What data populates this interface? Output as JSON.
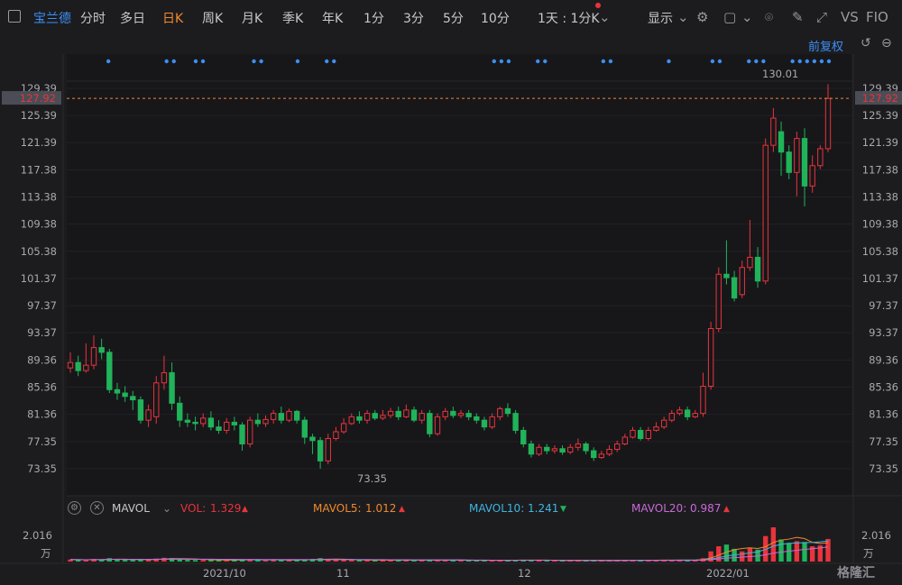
{
  "toolbar": {
    "stock_name": "宝兰德",
    "periods": [
      "分时",
      "多日",
      "日K",
      "周K",
      "月K",
      "季K",
      "年K",
      "1分",
      "3分",
      "5分",
      "10分",
      "1天 : 1分K"
    ],
    "active_period": "日K",
    "display_label": "显示",
    "compare_label": "VS",
    "f10_label": "FIO"
  },
  "chart_header": {
    "adjust_label": "前复权"
  },
  "price_axis": {
    "ticks": [
      "129.39",
      "125.39",
      "121.39",
      "117.38",
      "113.38",
      "109.38",
      "105.38",
      "101.37",
      "97.37",
      "93.37",
      "89.36",
      "85.36",
      "81.36",
      "77.35",
      "73.35"
    ],
    "current_price": "127.92",
    "high_label": "130.01",
    "low_label": "73.35"
  },
  "date_axis": {
    "labels": [
      "2021/10",
      "11",
      "12",
      "2022/01"
    ]
  },
  "volume": {
    "indicator": "MAVOL",
    "vol_label": "VOL:",
    "vol_value": "1.329",
    "mavol5_label": "MAVOL5:",
    "mavol5_value": "1.012",
    "mavol10_label": "MAVOL10:",
    "mavol10_value": "1.241",
    "mavol20_label": "MAVOL20:",
    "mavol20_value": "0.987",
    "axis_max": "2.016",
    "axis_unit": "万"
  },
  "colors": {
    "up": "#e8343c",
    "down": "#21b35a",
    "accent": "#3d8ff5",
    "active": "#f08a2c",
    "mavol5": "#f08a2c",
    "mavol10": "#3fb6e0",
    "mavol20": "#c86ad6"
  },
  "logo": "格隆汇",
  "chart_data": {
    "type": "candlestick",
    "y_range": [
      73.35,
      130.01
    ],
    "candles": [
      {
        "o": 88.2,
        "c": 89.0,
        "h": 90.5,
        "l": 87.5
      },
      {
        "o": 89.0,
        "c": 87.8,
        "h": 90.0,
        "l": 87.0
      },
      {
        "o": 87.8,
        "c": 88.6,
        "h": 91.8,
        "l": 87.5
      },
      {
        "o": 88.6,
        "c": 91.2,
        "h": 93.0,
        "l": 88.0
      },
      {
        "o": 91.2,
        "c": 90.5,
        "h": 92.5,
        "l": 89.5
      },
      {
        "o": 90.5,
        "c": 85.0,
        "h": 91.0,
        "l": 84.5
      },
      {
        "o": 85.0,
        "c": 84.5,
        "h": 86.0,
        "l": 83.5
      },
      {
        "o": 84.5,
        "c": 84.0,
        "h": 85.5,
        "l": 83.2
      },
      {
        "o": 84.0,
        "c": 83.5,
        "h": 84.8,
        "l": 82.0
      },
      {
        "o": 83.5,
        "c": 80.5,
        "h": 84.0,
        "l": 80.0
      },
      {
        "o": 80.5,
        "c": 82.0,
        "h": 82.8,
        "l": 79.5
      },
      {
        "o": 81.0,
        "c": 86.0,
        "h": 87.0,
        "l": 80.0
      },
      {
        "o": 86.0,
        "c": 87.5,
        "h": 90.0,
        "l": 85.0
      },
      {
        "o": 87.5,
        "c": 83.0,
        "h": 89.0,
        "l": 82.0
      },
      {
        "o": 83.0,
        "c": 80.5,
        "h": 84.0,
        "l": 79.5
      },
      {
        "o": 80.5,
        "c": 80.2,
        "h": 81.5,
        "l": 79.5
      },
      {
        "o": 80.2,
        "c": 80.0,
        "h": 81.0,
        "l": 79.0
      },
      {
        "o": 80.0,
        "c": 80.8,
        "h": 81.5,
        "l": 79.5
      },
      {
        "o": 80.8,
        "c": 79.5,
        "h": 81.8,
        "l": 79.0
      },
      {
        "o": 79.5,
        "c": 79.0,
        "h": 80.5,
        "l": 78.5
      },
      {
        "o": 79.0,
        "c": 80.2,
        "h": 80.8,
        "l": 78.5
      },
      {
        "o": 80.2,
        "c": 79.8,
        "h": 81.0,
        "l": 79.0
      },
      {
        "o": 79.8,
        "c": 77.0,
        "h": 80.2,
        "l": 76.0
      },
      {
        "o": 77.0,
        "c": 80.5,
        "h": 81.0,
        "l": 76.5
      },
      {
        "o": 80.5,
        "c": 80.0,
        "h": 81.5,
        "l": 79.5
      },
      {
        "o": 80.0,
        "c": 80.6,
        "h": 81.2,
        "l": 79.5
      },
      {
        "o": 80.6,
        "c": 81.5,
        "h": 82.0,
        "l": 80.0
      },
      {
        "o": 81.5,
        "c": 80.5,
        "h": 82.5,
        "l": 80.0
      },
      {
        "o": 80.5,
        "c": 81.8,
        "h": 82.2,
        "l": 80.2
      },
      {
        "o": 81.8,
        "c": 80.5,
        "h": 82.0,
        "l": 80.0
      },
      {
        "o": 80.5,
        "c": 78.0,
        "h": 81.0,
        "l": 77.0
      },
      {
        "o": 78.0,
        "c": 77.5,
        "h": 78.5,
        "l": 75.5
      },
      {
        "o": 77.5,
        "c": 74.5,
        "h": 78.0,
        "l": 73.35
      },
      {
        "o": 74.5,
        "c": 77.8,
        "h": 78.5,
        "l": 74.0
      },
      {
        "o": 77.8,
        "c": 78.8,
        "h": 79.5,
        "l": 77.5
      },
      {
        "o": 78.8,
        "c": 80.0,
        "h": 80.8,
        "l": 78.5
      },
      {
        "o": 80.0,
        "c": 81.0,
        "h": 81.5,
        "l": 79.8
      },
      {
        "o": 81.0,
        "c": 80.5,
        "h": 81.8,
        "l": 80.0
      },
      {
        "o": 80.5,
        "c": 81.5,
        "h": 82.0,
        "l": 80.0
      },
      {
        "o": 81.5,
        "c": 80.8,
        "h": 82.0,
        "l": 80.5
      },
      {
        "o": 80.8,
        "c": 81.2,
        "h": 82.0,
        "l": 80.5
      },
      {
        "o": 81.2,
        "c": 81.8,
        "h": 82.3,
        "l": 80.8
      },
      {
        "o": 81.8,
        "c": 81.0,
        "h": 82.5,
        "l": 80.5
      },
      {
        "o": 81.0,
        "c": 82.0,
        "h": 82.8,
        "l": 80.8
      },
      {
        "o": 82.0,
        "c": 80.5,
        "h": 82.5,
        "l": 80.2
      },
      {
        "o": 80.5,
        "c": 81.5,
        "h": 82.0,
        "l": 80.0
      },
      {
        "o": 81.5,
        "c": 78.5,
        "h": 82.0,
        "l": 78.0
      },
      {
        "o": 78.5,
        "c": 81.0,
        "h": 81.5,
        "l": 78.2
      },
      {
        "o": 81.0,
        "c": 81.8,
        "h": 82.3,
        "l": 80.5
      },
      {
        "o": 81.8,
        "c": 81.2,
        "h": 82.5,
        "l": 80.8
      },
      {
        "o": 81.2,
        "c": 81.5,
        "h": 82.0,
        "l": 80.8
      },
      {
        "o": 81.5,
        "c": 81.0,
        "h": 82.0,
        "l": 80.5
      },
      {
        "o": 81.0,
        "c": 80.5,
        "h": 81.5,
        "l": 80.0
      },
      {
        "o": 80.5,
        "c": 79.5,
        "h": 81.0,
        "l": 79.0
      },
      {
        "o": 79.5,
        "c": 81.0,
        "h": 81.5,
        "l": 79.2
      },
      {
        "o": 81.0,
        "c": 82.2,
        "h": 82.5,
        "l": 80.5
      },
      {
        "o": 82.2,
        "c": 81.5,
        "h": 83.0,
        "l": 81.0
      },
      {
        "o": 81.5,
        "c": 79.0,
        "h": 82.0,
        "l": 78.5
      },
      {
        "o": 79.0,
        "c": 77.0,
        "h": 79.5,
        "l": 76.5
      },
      {
        "o": 77.0,
        "c": 75.5,
        "h": 77.5,
        "l": 75.0
      },
      {
        "o": 75.5,
        "c": 76.5,
        "h": 77.0,
        "l": 75.2
      },
      {
        "o": 76.5,
        "c": 76.0,
        "h": 77.0,
        "l": 75.5
      },
      {
        "o": 76.0,
        "c": 76.3,
        "h": 76.8,
        "l": 75.6
      },
      {
        "o": 76.3,
        "c": 75.8,
        "h": 76.8,
        "l": 75.4
      },
      {
        "o": 75.8,
        "c": 76.5,
        "h": 77.0,
        "l": 75.5
      },
      {
        "o": 76.5,
        "c": 77.0,
        "h": 77.8,
        "l": 76.0
      },
      {
        "o": 77.0,
        "c": 76.0,
        "h": 77.3,
        "l": 75.5
      },
      {
        "o": 76.0,
        "c": 75.0,
        "h": 76.5,
        "l": 74.5
      },
      {
        "o": 75.0,
        "c": 75.5,
        "h": 76.0,
        "l": 74.8
      },
      {
        "o": 75.5,
        "c": 76.2,
        "h": 76.8,
        "l": 75.2
      },
      {
        "o": 76.2,
        "c": 77.0,
        "h": 77.5,
        "l": 75.8
      },
      {
        "o": 77.0,
        "c": 78.0,
        "h": 78.5,
        "l": 76.8
      },
      {
        "o": 78.0,
        "c": 79.0,
        "h": 79.5,
        "l": 77.8
      },
      {
        "o": 79.0,
        "c": 77.8,
        "h": 79.5,
        "l": 77.5
      },
      {
        "o": 77.8,
        "c": 79.0,
        "h": 79.5,
        "l": 77.5
      },
      {
        "o": 79.0,
        "c": 79.5,
        "h": 80.2,
        "l": 78.8
      },
      {
        "o": 79.5,
        "c": 80.5,
        "h": 81.0,
        "l": 79.2
      },
      {
        "o": 80.5,
        "c": 81.5,
        "h": 82.0,
        "l": 80.2
      },
      {
        "o": 81.5,
        "c": 82.0,
        "h": 82.5,
        "l": 81.2
      },
      {
        "o": 82.0,
        "c": 81.0,
        "h": 82.5,
        "l": 80.5
      },
      {
        "o": 81.0,
        "c": 81.5,
        "h": 82.0,
        "l": 80.8
      },
      {
        "o": 81.5,
        "c": 85.5,
        "h": 87.5,
        "l": 81.0
      },
      {
        "o": 85.5,
        "c": 94.0,
        "h": 95.0,
        "l": 85.0
      },
      {
        "o": 94.0,
        "c": 102.0,
        "h": 103.0,
        "l": 93.5
      },
      {
        "o": 102.0,
        "c": 101.5,
        "h": 107.0,
        "l": 100.5
      },
      {
        "o": 101.5,
        "c": 98.5,
        "h": 102.5,
        "l": 98.0
      },
      {
        "o": 99.0,
        "c": 103.0,
        "h": 104.0,
        "l": 98.5
      },
      {
        "o": 103.0,
        "c": 104.5,
        "h": 110.0,
        "l": 102.5
      },
      {
        "o": 104.5,
        "c": 101.0,
        "h": 106.0,
        "l": 100.0
      },
      {
        "o": 101.0,
        "c": 121.0,
        "h": 122.0,
        "l": 100.5
      },
      {
        "o": 121.0,
        "c": 125.0,
        "h": 126.5,
        "l": 120.0
      },
      {
        "o": 123.0,
        "c": 120.0,
        "h": 124.5,
        "l": 116.5
      },
      {
        "o": 120.0,
        "c": 117.0,
        "h": 121.0,
        "l": 116.0
      },
      {
        "o": 117.0,
        "c": 122.0,
        "h": 123.0,
        "l": 113.5
      },
      {
        "o": 122.0,
        "c": 115.0,
        "h": 123.5,
        "l": 112.0
      },
      {
        "o": 115.0,
        "c": 118.0,
        "h": 119.5,
        "l": 114.0
      },
      {
        "o": 118.0,
        "c": 120.5,
        "h": 121.0,
        "l": 117.5
      },
      {
        "o": 120.5,
        "c": 127.9,
        "h": 130.01,
        "l": 120.0
      }
    ],
    "volumes": [
      0.12,
      0.1,
      0.09,
      0.15,
      0.11,
      0.2,
      0.14,
      0.1,
      0.09,
      0.13,
      0.12,
      0.18,
      0.22,
      0.2,
      0.14,
      0.1,
      0.09,
      0.1,
      0.09,
      0.08,
      0.09,
      0.08,
      0.12,
      0.15,
      0.1,
      0.09,
      0.1,
      0.09,
      0.1,
      0.09,
      0.13,
      0.15,
      0.2,
      0.14,
      0.1,
      0.1,
      0.09,
      0.08,
      0.09,
      0.08,
      0.08,
      0.09,
      0.08,
      0.09,
      0.08,
      0.08,
      0.1,
      0.09,
      0.08,
      0.07,
      0.08,
      0.07,
      0.07,
      0.08,
      0.07,
      0.08,
      0.07,
      0.1,
      0.11,
      0.08,
      0.07,
      0.06,
      0.06,
      0.06,
      0.07,
      0.07,
      0.06,
      0.07,
      0.06,
      0.07,
      0.08,
      0.08,
      0.09,
      0.08,
      0.08,
      0.08,
      0.09,
      0.1,
      0.09,
      0.08,
      0.09,
      0.2,
      0.6,
      0.9,
      1.0,
      0.75,
      0.6,
      0.8,
      0.7,
      1.5,
      2.016,
      1.3,
      1.1,
      1.2,
      1.15,
      0.9,
      0.95,
      1.329
    ],
    "event_dot_rows": "top"
  }
}
